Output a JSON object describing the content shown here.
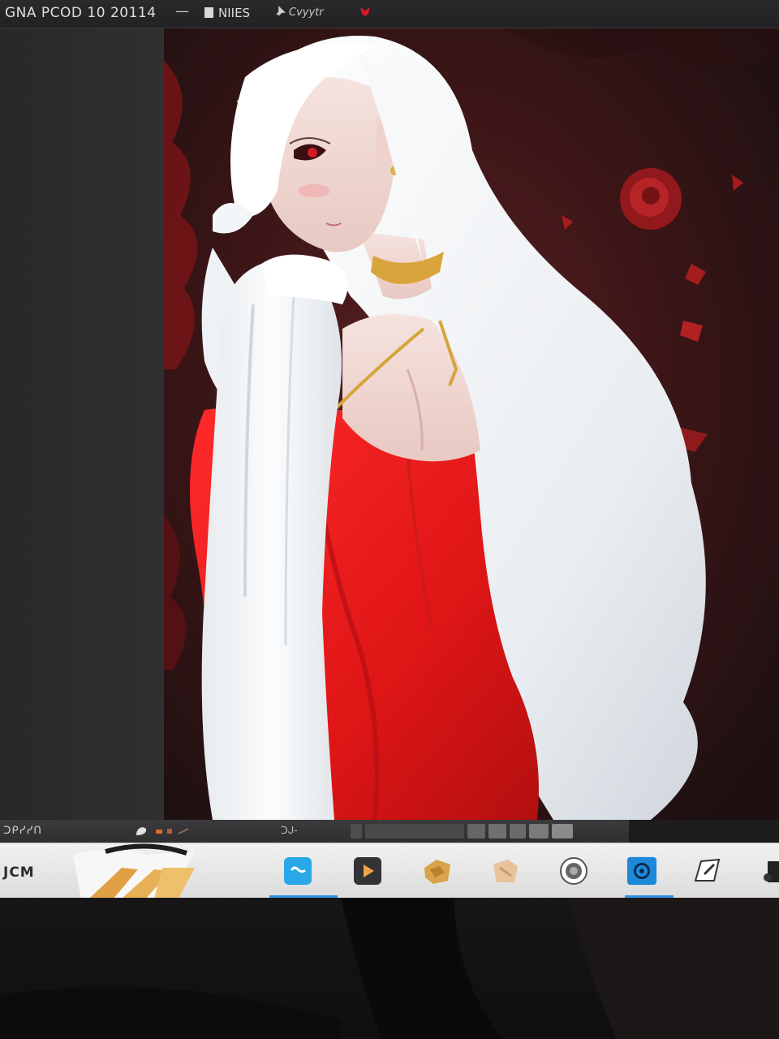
{
  "window": {
    "title": "GNA PCOD 10 20114",
    "separator": "—",
    "menu_item_1": "NIIES",
    "menu_item_2": "Cvyytr"
  },
  "statusbar": {
    "left_label": "ᑐᑭᓯᓯᑎ",
    "mid_label": "ᑐᒍ-",
    "slider_segments": 7
  },
  "taskbar": {
    "system_label": "JCM",
    "apps": [
      {
        "icon": "blue-chat-icon",
        "color": "#2aa7e6"
      },
      {
        "icon": "media-player-icon",
        "color": "#3a3a3a"
      },
      {
        "icon": "folder-puzzle-icon",
        "color": "#d8a34a"
      },
      {
        "icon": "notes-icon",
        "color": "#e3b585"
      },
      {
        "icon": "camera-lens-icon",
        "color": "#777777"
      },
      {
        "icon": "screen-recorder-icon",
        "color": "#1e88d9"
      },
      {
        "icon": "pen-edit-icon",
        "color": "#3a3a3a"
      }
    ]
  },
  "colors": {
    "dress_red": "#e01a1a",
    "hair_white": "#f1f3f5",
    "background_dark_red": "#3a1112",
    "accent_blue": "#2f8fe0"
  }
}
